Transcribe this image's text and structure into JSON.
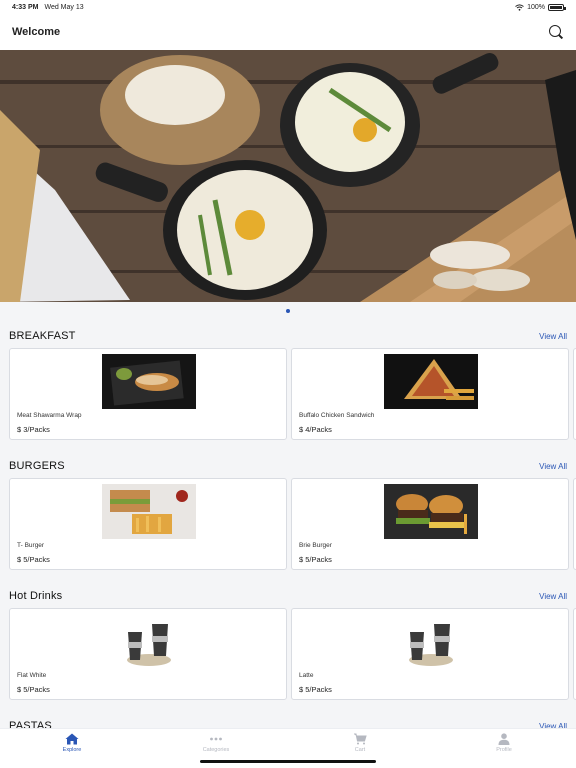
{
  "status_bar": {
    "time": "4:33 PM",
    "date": "Wed May 13",
    "battery": "100%"
  },
  "header": {
    "title": "Welcome"
  },
  "sections": [
    {
      "title": "BREAKFAST",
      "view_all": "View All",
      "items": [
        {
          "name": "Meat Shawarma Wrap",
          "price": "$ 3/Packs"
        },
        {
          "name": "Buffalo Chicken Sandwich",
          "price": "$ 4/Packs"
        }
      ]
    },
    {
      "title": "BURGERS",
      "view_all": "View All",
      "items": [
        {
          "name": "T- Burger",
          "price": "$ 5/Packs"
        },
        {
          "name": "Brie Burger",
          "price": "$ 5/Packs"
        }
      ]
    },
    {
      "title": "Hot Drinks",
      "view_all": "View All",
      "items": [
        {
          "name": "Flat White",
          "price": "$ 5/Packs"
        },
        {
          "name": "Latte",
          "price": "$ 5/Packs"
        }
      ]
    },
    {
      "title": "PASTAS",
      "view_all": "View All",
      "items": []
    }
  ],
  "tabs": [
    {
      "label": "Explore",
      "icon": "home-icon",
      "active": true
    },
    {
      "label": "Categories",
      "icon": "dots-icon",
      "active": false
    },
    {
      "label": "Cart",
      "icon": "cart-icon",
      "active": false
    },
    {
      "label": "Profile",
      "icon": "person-icon",
      "active": false
    }
  ],
  "colors": {
    "accent": "#2a56b5",
    "inactive_tab": "#b5b8c0",
    "background": "#f4f5f7"
  }
}
